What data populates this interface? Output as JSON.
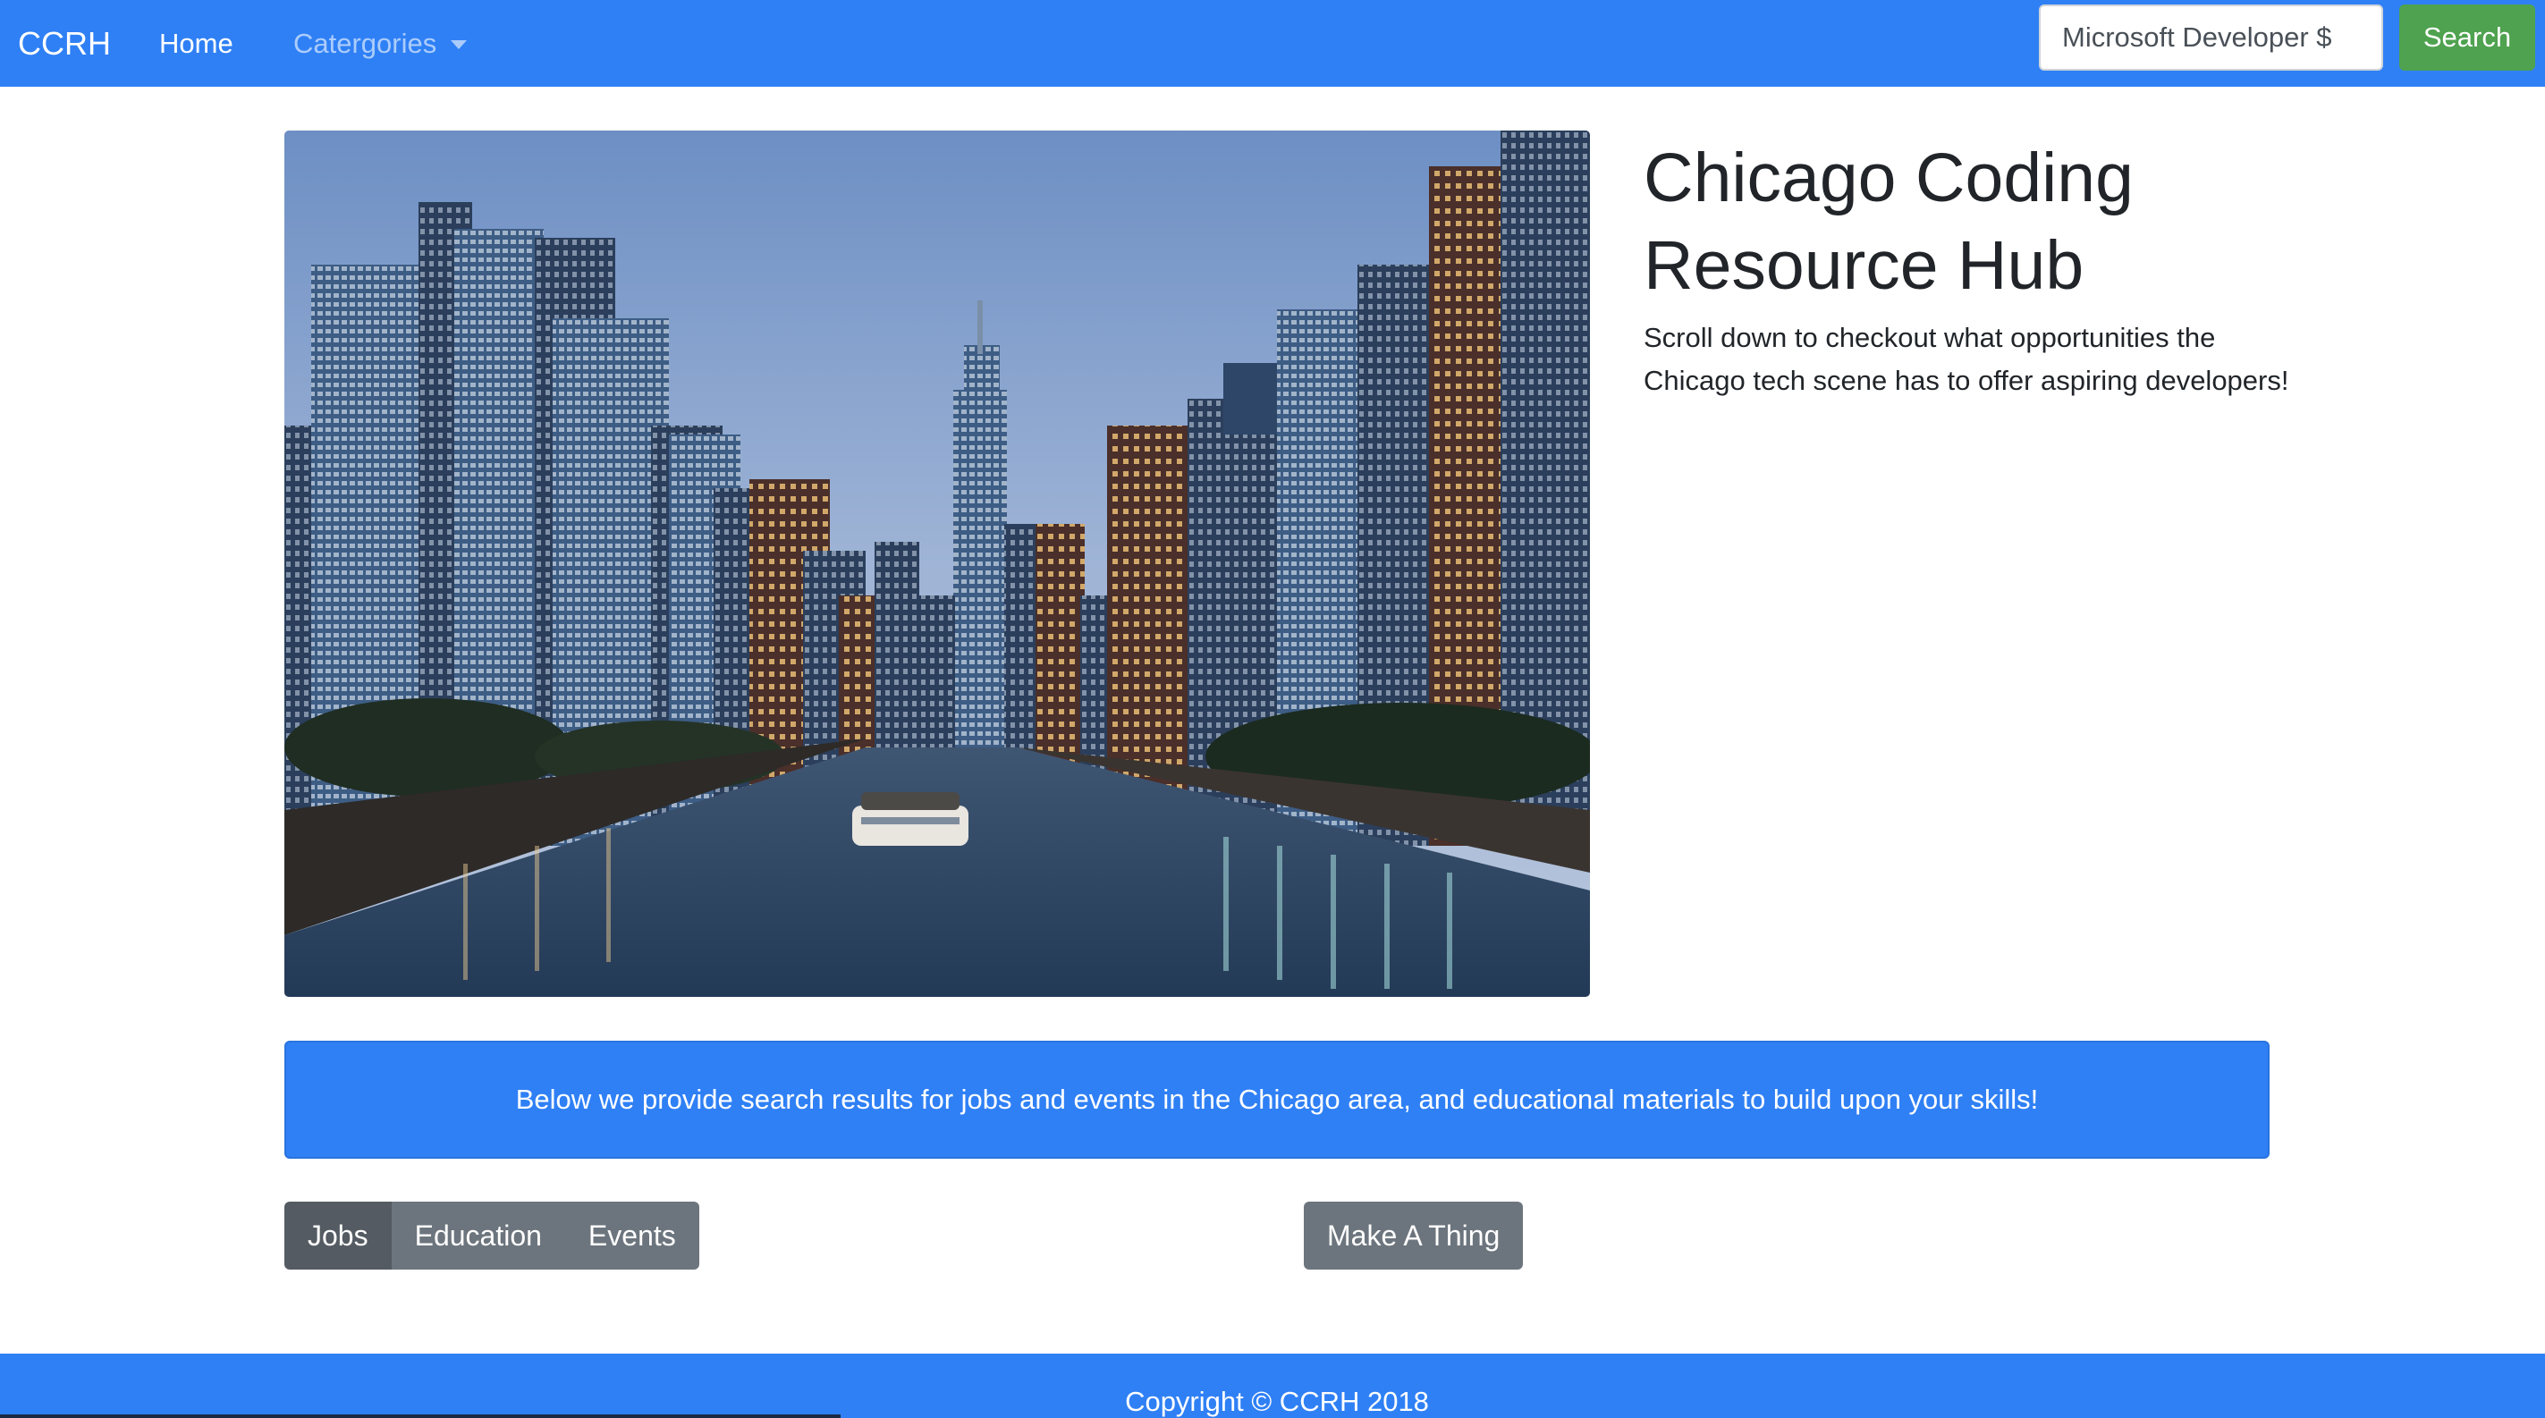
{
  "navbar": {
    "brand": "CCRH",
    "home_label": "Home",
    "categories_label": "Catergories",
    "search": {
      "value": "Microsoft Developer $",
      "button_label": "Search"
    }
  },
  "hero": {
    "image_icon": "city-skyline-photo",
    "title": "Chicago Coding Resource Hub",
    "text": "Scroll down to checkout what opportunities the Chicago tech scene has to offer aspiring developers!"
  },
  "banner": {
    "text": "Below we provide search results for jobs and events in the Chicago area, and educational materials to build upon your skills!"
  },
  "tabs": {
    "items": [
      {
        "label": "Jobs",
        "active": true
      },
      {
        "label": "Education",
        "active": false
      },
      {
        "label": "Events",
        "active": false
      }
    ],
    "make_thing_label": "Make A Thing"
  },
  "footer": {
    "text": "Copyright © CCRH 2018"
  },
  "colors": {
    "primary": "#2f80f5",
    "success": "#4fa24f",
    "secondary": "#6c757d",
    "secondary_active": "#545b62"
  }
}
